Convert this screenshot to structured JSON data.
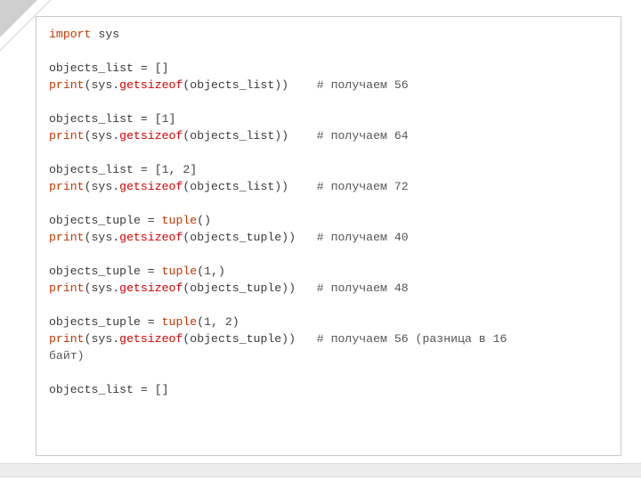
{
  "code": {
    "kw_import": "import",
    "mod_sys": "sys",
    "list_empty": "objects_list = []",
    "print": "print",
    "getsizeof": "getsizeof",
    "arg_list": "(sys.",
    "arg_list_close": "(objects_list))",
    "cm_56": "# получаем 56",
    "list_one_a": "objects_list = [",
    "num1": "1",
    "list_one_b": "]",
    "cm_64": "# получаем 64",
    "list_two_a": "objects_list = [",
    "list_two_sep": ", ",
    "num2": "2",
    "list_two_b": "]",
    "cm_72": "# получаем 72",
    "tuple_assign_a": "objects_tuple = ",
    "tuple_kw": "tuple",
    "tuple_empty_args": "()",
    "arg_tuple_close": "(objects_tuple))",
    "cm_40": "# получаем 40",
    "tuple_one_args_a": "(",
    "tuple_one_args_b": ",)",
    "cm_48": "# получаем 48",
    "tuple_two_args_a": "(",
    "tuple_two_args_sep": ", ",
    "tuple_two_args_b": ")",
    "cm_56b": "# получаем 56 (разница в 16",
    "cm_56b_wrap": "байт)",
    "list_empty2": "objects_list = []",
    "pad": "    "
  }
}
